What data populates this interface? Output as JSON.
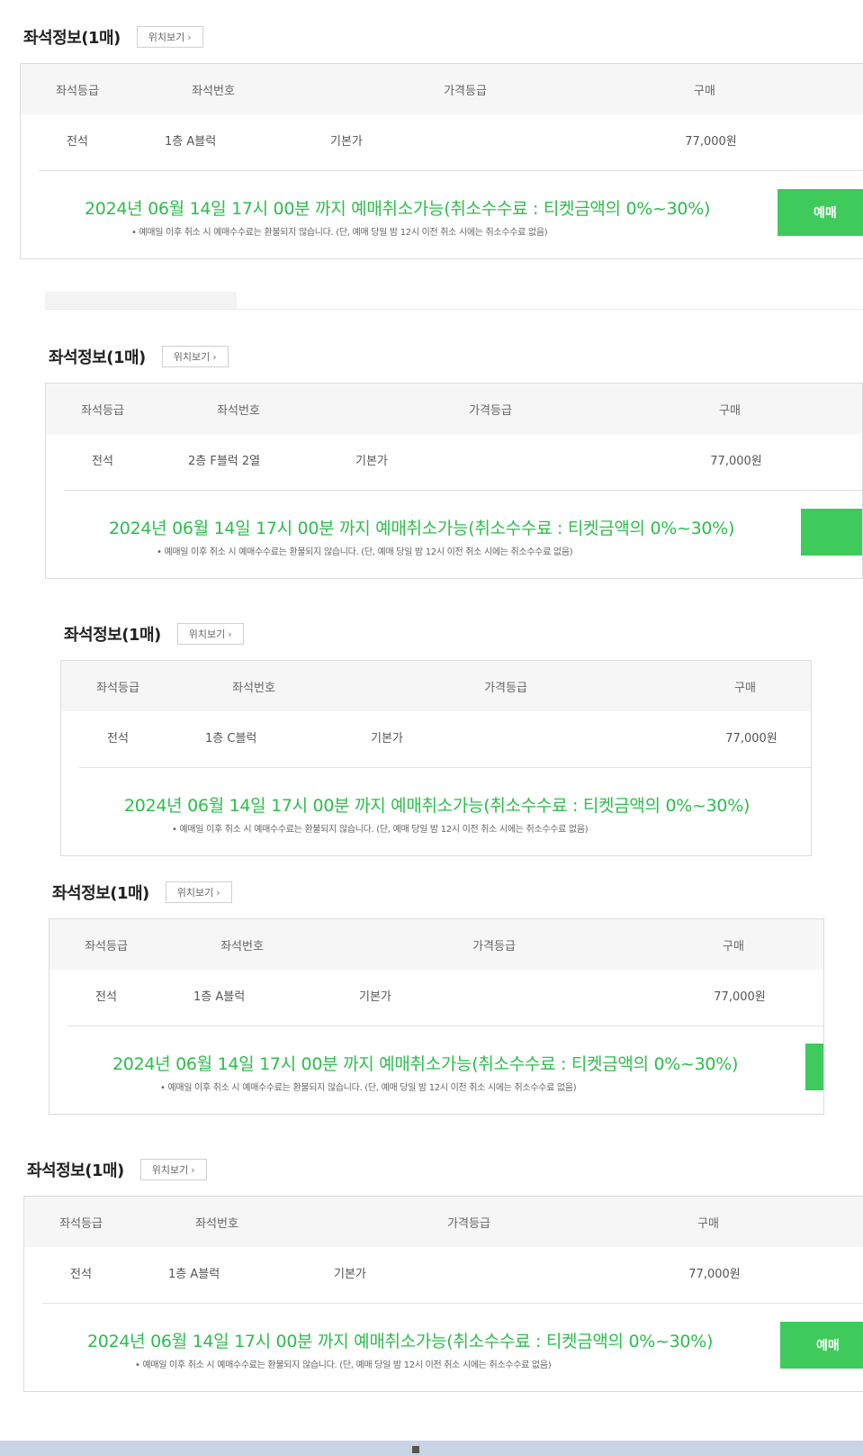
{
  "sections": [
    {
      "title": "좌석정보(1매)",
      "location_label": "위치보기",
      "headers": [
        "좌석등급",
        "좌석번호",
        "가격등급",
        "구매"
      ],
      "row": {
        "grade": "전석",
        "seat": "1층 A블럭",
        "price_grade": "기본가",
        "price": "77,000원"
      },
      "notice": "2024년 06월 14일 17시 00분 까지 예매취소가능(취소수수료 : 티켓금액의 0%~30%)",
      "sub_notice": "• 예매일 이후 취소 시 예매수수료는 환불되지 않습니다. (단, 예매 당일 밤 12시 이전 취소 시에는 취소수수료 없음)",
      "button_label": "예매"
    },
    {
      "title": "좌석정보(1매)",
      "location_label": "위치보기",
      "headers": [
        "좌석등급",
        "좌석번호",
        "가격등급",
        "구매"
      ],
      "row": {
        "grade": "전석",
        "seat": "2층 F블럭 2열",
        "price_grade": "기본가",
        "price": "77,000원"
      },
      "notice": "2024년 06월 14일 17시 00분 까지 예매취소가능(취소수수료 : 티켓금액의 0%~30%)",
      "sub_notice": "• 예매일 이후 취소 시 예매수수료는 환불되지 않습니다. (단, 예매 당일 밤 12시 이전 취소 시에는 취소수수료 없음)",
      "button_label": ""
    },
    {
      "title": "좌석정보(1매)",
      "location_label": "위치보기",
      "headers": [
        "좌석등급",
        "좌석번호",
        "가격등급",
        "구매"
      ],
      "row": {
        "grade": "전석",
        "seat": "1층 C블럭",
        "price_grade": "기본가",
        "price": "77,000원"
      },
      "notice": "2024년 06월 14일 17시 00분 까지 예매취소가능(취소수수료 : 티켓금액의 0%~30%)",
      "sub_notice": "• 예매일 이후 취소 시 예매수수료는 환불되지 않습니다. (단, 예매 당일 밤 12시 이전 취소 시에는 취소수수료 없음)",
      "button_label": ""
    },
    {
      "title": "좌석정보(1매)",
      "location_label": "위치보기",
      "headers": [
        "좌석등급",
        "좌석번호",
        "가격등급",
        "구매"
      ],
      "row": {
        "grade": "전석",
        "seat": "1층 A블럭",
        "price_grade": "기본가",
        "price": "77,000원"
      },
      "notice": "2024년 06월 14일 17시 00분 까지 예매취소가능(취소수수료 : 티켓금액의 0%~30%)",
      "sub_notice": "• 예매일 이후 취소 시 예매수수료는 환불되지 않습니다. (단, 예매 당일 밤 12시 이전 취소 시에는 취소수수료 없음)",
      "button_label": ""
    },
    {
      "title": "좌석정보(1매)",
      "location_label": "위치보기",
      "headers": [
        "좌석등급",
        "좌석번호",
        "가격등급",
        "구매"
      ],
      "row": {
        "grade": "전석",
        "seat": "1층 A블럭",
        "price_grade": "기본가",
        "price": "77,000원"
      },
      "notice": "2024년 06월 14일 17시 00분 까지 예매취소가능(취소수수료 : 티켓금액의 0%~30%)",
      "sub_notice": "• 예매일 이후 취소 시 예매수수료는 환불되지 않습니다. (단, 예매 당일 밤 12시 이전 취소 시에는 취소수수료 없음)",
      "button_label": "예매"
    }
  ],
  "colors": {
    "notice_green": "#2dbd4c",
    "button_green": "#3fca5c",
    "header_bg": "#f6f6f6"
  },
  "icons": {
    "location_chevron": "chevron-right-icon"
  }
}
